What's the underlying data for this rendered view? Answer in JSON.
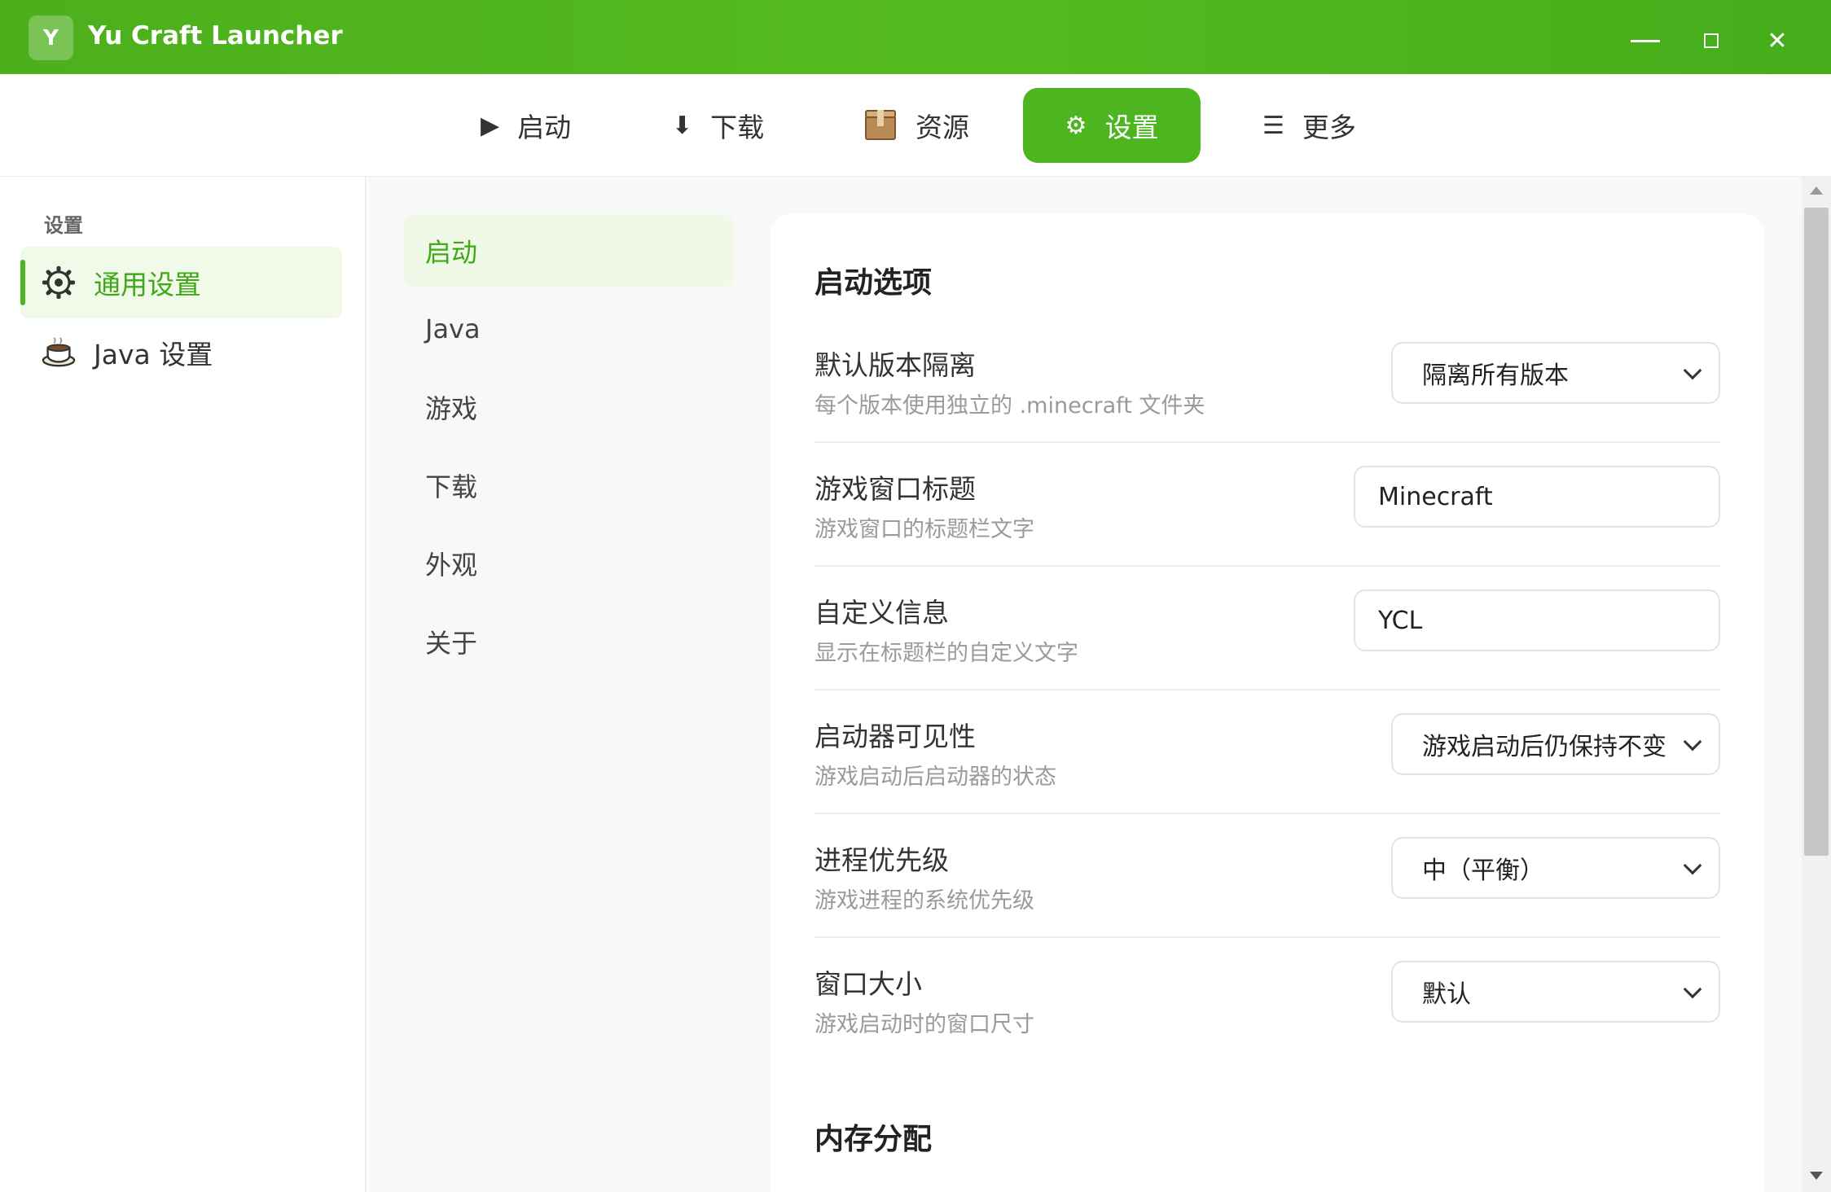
{
  "app": {
    "logo_letter": "Y",
    "title": "Yu Craft Launcher",
    "minimize_icon": "minimize-icon",
    "maximize_icon": "maximize-icon",
    "close_glyph": "✕"
  },
  "topnav": {
    "items": [
      {
        "label": "启动",
        "icon": "play-icon",
        "glyph": "▶"
      },
      {
        "label": "下载",
        "icon": "download-icon",
        "glyph": "⬇"
      },
      {
        "label": "资源",
        "icon": "box-icon"
      },
      {
        "label": "设置",
        "icon": "gear-icon",
        "glyph": "⚙",
        "active": true
      },
      {
        "label": "更多",
        "icon": "menu-icon",
        "glyph": "☰"
      }
    ]
  },
  "sidebar": {
    "heading": "设置",
    "items": [
      {
        "label": "通用设置",
        "icon": "gear-icon",
        "active": true
      },
      {
        "label": "Java 设置",
        "icon": "coffee-cup-icon"
      }
    ]
  },
  "subnav": {
    "items": [
      {
        "label": "启动",
        "active": true
      },
      {
        "label": "Java"
      },
      {
        "label": "游戏"
      },
      {
        "label": "下载"
      },
      {
        "label": "外观"
      },
      {
        "label": "关于"
      }
    ]
  },
  "main": {
    "section_launch": "启动选项",
    "section_memory": "内存分配",
    "rows": [
      {
        "title": "默认版本隔离",
        "desc": "每个版本使用独立的 .minecraft 文件夹",
        "control": "select",
        "value": "隔离所有版本"
      },
      {
        "title": "游戏窗口标题",
        "desc": "游戏窗口的标题栏文字",
        "control": "input",
        "value": "Minecraft"
      },
      {
        "title": "自定义信息",
        "desc": "显示在标题栏的自定义文字",
        "control": "input",
        "value": "YCL"
      },
      {
        "title": "启动器可见性",
        "desc": "游戏启动后启动器的状态",
        "control": "select",
        "value": "游戏启动后仍保持不变"
      },
      {
        "title": "进程优先级",
        "desc": "游戏进程的系统优先级",
        "control": "select",
        "value": "中（平衡）"
      },
      {
        "title": "窗口大小",
        "desc": "游戏启动时的窗口尺寸",
        "control": "select",
        "value": "默认"
      }
    ]
  },
  "colors": {
    "accent": "#4cb520",
    "titlebar": "#4caf1c",
    "active_bg": "#f1fae9"
  }
}
